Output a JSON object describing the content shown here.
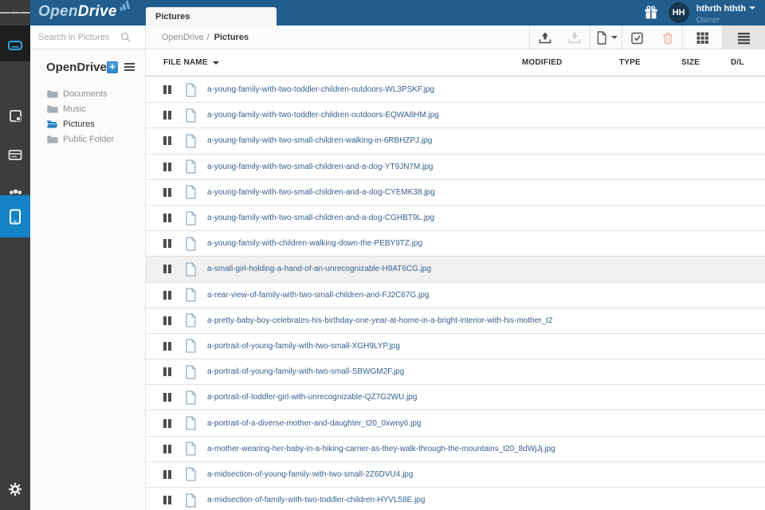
{
  "app": {
    "logo_part1": "Open",
    "logo_part2": "Drive"
  },
  "header": {
    "tab_label": "Pictures",
    "user": {
      "initials": "HH",
      "name": "hthrth hthth",
      "role": "Owner"
    }
  },
  "search": {
    "placeholder": "Search in Pictures"
  },
  "breadcrumb": {
    "root": "OpenDrive",
    "separator": "/",
    "current": "Pictures"
  },
  "toolbar": {
    "icons": [
      "upload",
      "download",
      "new-document",
      "select-all",
      "delete",
      "grid-view",
      "list-view"
    ],
    "active_view": "list-view"
  },
  "rail": {
    "icons": [
      "menu",
      "drive",
      "notes",
      "storage",
      "groups",
      "devices",
      "settings"
    ],
    "active": "devices"
  },
  "sidebar": {
    "title": "OpenDrive",
    "folders": [
      {
        "label": "Documents",
        "active": false
      },
      {
        "label": "Music",
        "active": false
      },
      {
        "label": "Pictures",
        "active": true
      },
      {
        "label": "Public Folder",
        "active": false
      }
    ]
  },
  "table": {
    "headers": {
      "name": "FILE NAME",
      "modified": "MODIFIED",
      "type": "TYPE",
      "size": "SIZE",
      "download": "D/L"
    },
    "rows": [
      {
        "name": "a-young-family-with-two-toddler-children-outdoors-WL3PSKF.jpg",
        "highlighted": false
      },
      {
        "name": "a-young-family-with-two-toddler-children-outdoors-EQWA8HM.jpg",
        "highlighted": false
      },
      {
        "name": "a-young-family-with-two-small-children-walking-in-6RBHZPJ.jpg",
        "highlighted": false
      },
      {
        "name": "a-young-family-with-two-small-children-and-a-dog-YT9JN7M.jpg",
        "highlighted": false
      },
      {
        "name": "a-young-family-with-two-small-children-and-a-dog-CYEMK38.jpg",
        "highlighted": false
      },
      {
        "name": "a-young-family-with-two-small-children-and-a-dog-CGHBT9L.jpg",
        "highlighted": false
      },
      {
        "name": "a-young-family-with-children-walking-down-the-PEBY9TZ.jpg",
        "highlighted": false
      },
      {
        "name": "a-small-girl-holding-a-hand-of-an-unrecognizable-H9AT6CG.jpg",
        "highlighted": true
      },
      {
        "name": "a-rear-view-of-family-with-two-small-children-and-FJ2C67G.jpg",
        "highlighted": false
      },
      {
        "name": "a-pretty-baby-boy-celebrates-his-birthday-one-year-at-home-in-a-bright-interior-with-his-mother_t2",
        "highlighted": false
      },
      {
        "name": "a-portrait-of-young-family-with-two-small-XGH9LYP.jpg",
        "highlighted": false
      },
      {
        "name": "a-portrait-of-young-family-with-two-small-SBWGM2F.jpg",
        "highlighted": false
      },
      {
        "name": "a-portrait-of-toddler-girl-with-unrecognizable-QZ7G2WU.jpg",
        "highlighted": false
      },
      {
        "name": "a-portrait-of-a-diverse-mother-and-daughter_t20_0xwny6.jpg",
        "highlighted": false
      },
      {
        "name": "a-mother-wearing-her-baby-in-a-hiking-carrier-as-they-walk-through-the-mountains_t20_8dWjJj.jpg",
        "highlighted": false
      },
      {
        "name": "a-midsection-of-young-family-with-two-small-2Z6DVU4.jpg",
        "highlighted": false
      },
      {
        "name": "a-midsection-of-family-with-two-toddler-children-HYVL58E.jpg",
        "highlighted": false
      }
    ]
  },
  "colors": {
    "header_bg": "#215e8e",
    "rail_active": "#1583c5",
    "link": "#36618f",
    "accent": "#3a97dd",
    "delete_disabled": "#eeb9a4"
  }
}
